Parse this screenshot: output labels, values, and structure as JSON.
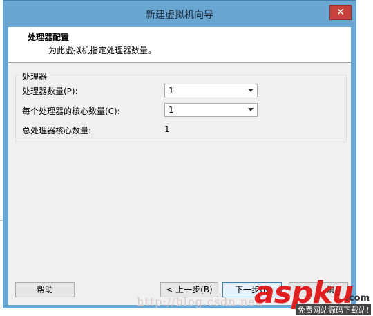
{
  "window": {
    "title": "新建虚拟机向导",
    "close_glyph": "✕"
  },
  "header": {
    "title": "处理器配置",
    "subtitle": "为此虚拟机指定处理器数量。"
  },
  "processor_group": {
    "legend": "处理器",
    "processor_count_label": "处理器数量(P):",
    "processor_count_value": "1",
    "cores_per_processor_label": "每个处理器的核心数量(C):",
    "cores_per_processor_value": "1",
    "total_cores_label": "总处理器核心数量:",
    "total_cores_value": "1"
  },
  "buttons": {
    "help": "帮助",
    "back": "< 上一步(B)",
    "next": "下一步(N",
    "cancel": "消"
  },
  "watermark": {
    "url": "http://blog.csdn.net/",
    "logo": "aspku",
    "logo_suffix": ".com",
    "tagline": "免费网站源码下载站!"
  }
}
